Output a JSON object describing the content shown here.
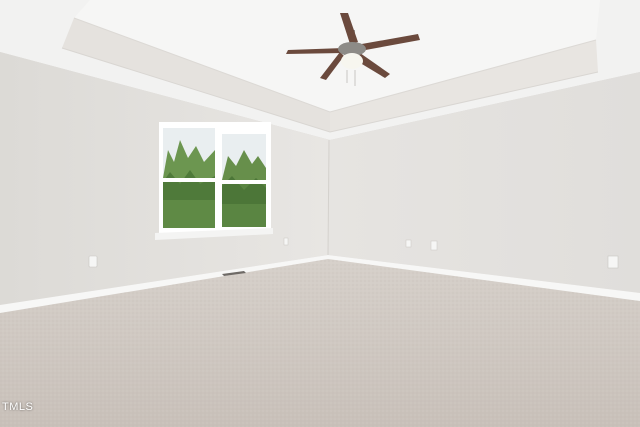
{
  "watermark": {
    "text": "TMLS"
  },
  "scene": {
    "description_icons": [
      "ceiling-fan-icon",
      "window-icon",
      "electrical-outlet-icon",
      "floor-vent-icon"
    ],
    "colors": {
      "ceiling": "#f3f3f2",
      "tray_soffit": "#e6e3df",
      "left_wall": "#e3e1dd",
      "right_wall": "#e9e7e4",
      "baseboard": "#f7f7f6",
      "carpet": "#cfc8c2",
      "window_frame": "#ffffff",
      "foliage": "#5f8a45",
      "sky": "#e8eef0",
      "fan_blade": "#6b4a3d",
      "fan_metal": "#9a9894"
    }
  }
}
